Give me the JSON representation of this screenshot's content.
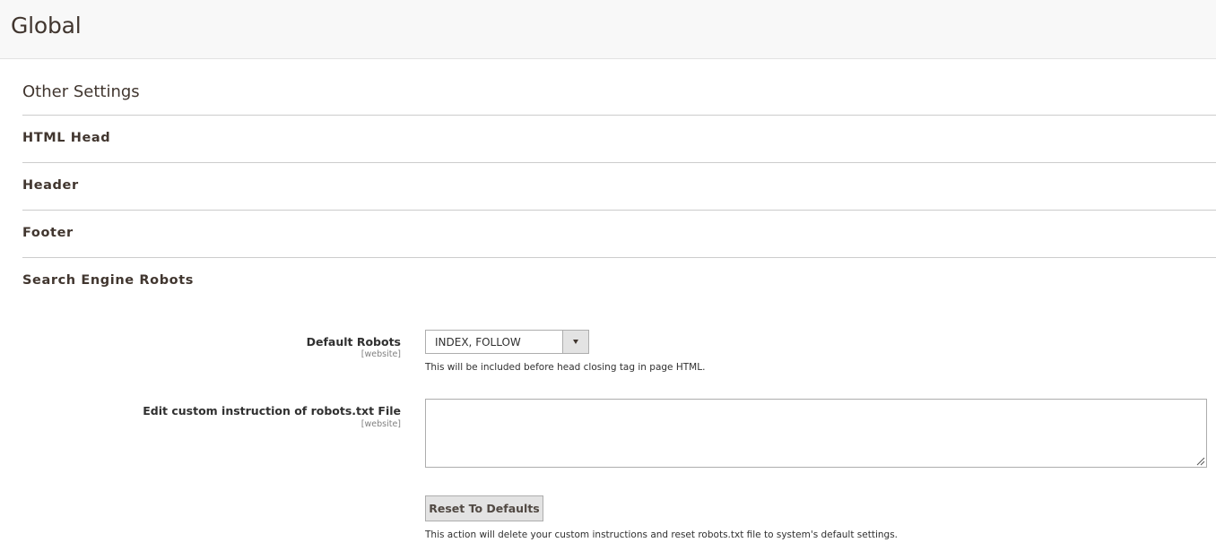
{
  "page": {
    "title": "Global"
  },
  "section": {
    "title": "Other Settings",
    "groups": [
      {
        "label": "HTML Head"
      },
      {
        "label": "Header"
      },
      {
        "label": "Footer"
      },
      {
        "label": "Search Engine Robots"
      }
    ]
  },
  "robots": {
    "default_robots": {
      "label": "Default Robots",
      "scope": "[website]",
      "value": "INDEX, FOLLOW",
      "note": "This will be included before head closing tag in page HTML."
    },
    "custom_instruction": {
      "label": "Edit custom instruction of robots.txt File",
      "scope": "[website]",
      "value": ""
    },
    "reset": {
      "button_label": "Reset To Defaults",
      "note": "This action will delete your custom instructions and reset robots.txt file to system's default settings."
    }
  },
  "colors": {
    "header_bg": "#f8f8f8",
    "text_dark": "#41362f",
    "rule": "#cccccc",
    "button_bg": "#e3e3e3",
    "border": "#adadad"
  },
  "icons": {
    "select_arrow": "caret-down-icon",
    "resize": "resize-grip-icon"
  }
}
